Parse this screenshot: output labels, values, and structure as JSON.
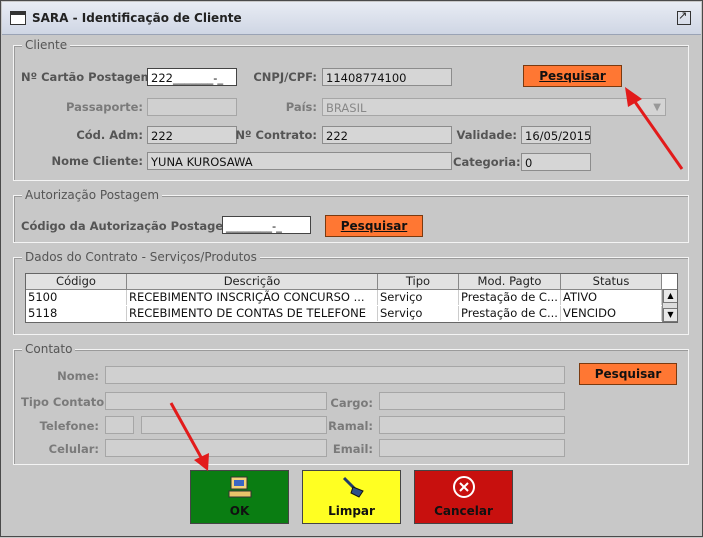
{
  "window": {
    "title": "SARA - Identificação de Cliente"
  },
  "cliente": {
    "legend": "Cliente",
    "cartao_label": "Nº Cartão Postagem:",
    "cartao_value": "222_______-_",
    "cnpj_label": "CNPJ/CPF:",
    "cnpj_value": "11408774100",
    "pesquisar": "Pesquisar",
    "passaporte_label": "Passaporte:",
    "passaporte_value": "",
    "pais_label": "País:",
    "pais_value": "BRASIL",
    "cod_adm_label": "Cód. Adm:",
    "cod_adm_value": "222",
    "contrato_label": "Nº Contrato:",
    "contrato_value": "222",
    "validade_label": "Validade:",
    "validade_value": "16/05/2015",
    "nome_label": "Nome Cliente:",
    "nome_value": "YUNA KUROSAWA",
    "categoria_label": "Categoria:",
    "categoria_value": "0"
  },
  "autorizacao": {
    "legend": "Autorização Postagem",
    "codigo_label": "Código da Autorização Postagem:",
    "codigo_value": "________-_",
    "pesquisar": "Pesquisar"
  },
  "contrato": {
    "legend": "Dados do Contrato - Serviços/Produtos",
    "columns": [
      "Código",
      "Descrição",
      "Tipo",
      "Mod. Pagto",
      "Status"
    ],
    "rows": [
      [
        "5100",
        "RECEBIMENTO INSCRIÇÃO CONCURSO ...",
        "Serviço",
        "Prestação de C...",
        "ATIVO"
      ],
      [
        "5118",
        "RECEBIMENTO DE CONTAS DE TELEFONE",
        "Serviço",
        "Prestação de C...",
        "VENCIDO"
      ]
    ]
  },
  "contato": {
    "legend": "Contato",
    "nome_label": "Nome:",
    "pesquisar": "Pesquisar",
    "tipo_label": "Tipo Contato:",
    "cargo_label": "Cargo:",
    "telefone_label": "Telefone:",
    "ramal_label": "Ramal:",
    "celular_label": "Celular:",
    "email_label": "Email:"
  },
  "buttons": {
    "ok": "OK",
    "limpar": "Limpar",
    "cancelar": "Cancelar"
  },
  "colors": {
    "accent_orange": "#ff7733",
    "ok_green": "#0a7d12",
    "limpar_yellow": "#ffff22",
    "cancelar_red": "#c8100e",
    "arrow_red": "#e21b1b"
  }
}
